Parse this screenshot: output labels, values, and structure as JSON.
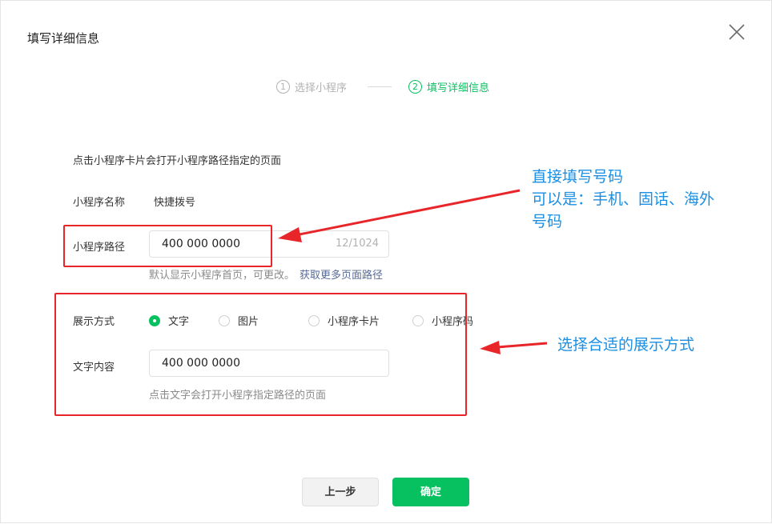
{
  "dialog": {
    "title": "填写详细信息"
  },
  "steps": [
    {
      "num": "1",
      "label": "选择小程序",
      "state": "inactive"
    },
    {
      "num": "2",
      "label": "填写详细信息",
      "state": "active"
    }
  ],
  "form": {
    "description": "点击小程序卡片会打开小程序路径指定的页面",
    "name_label": "小程序名称",
    "name_value": "快捷拨号",
    "path_label": "小程序路径",
    "path_value": "400 000 0000",
    "path_counter": "12/1024",
    "path_hint": "默认显示小程序首页，可更改。",
    "path_hint_link": "获取更多页面路径",
    "display_label": "展示方式",
    "display_options": [
      "文字",
      "图片",
      "小程序卡片",
      "小程序码"
    ],
    "display_selected": "文字",
    "text_label": "文字内容",
    "text_value": "400 000 0000",
    "text_hint": "点击文字会打开小程序指定路径的页面"
  },
  "annotations": {
    "top_line1": "直接填写号码",
    "top_line2": "可以是：手机、固话、海外",
    "top_line3": "号码",
    "bottom": "选择合适的展示方式"
  },
  "buttons": {
    "prev": "上一步",
    "ok": "确定"
  },
  "colors": {
    "accent": "#07c160",
    "annotation_red": "#e8262a",
    "annotation_blue": "#1a8fe3",
    "link": "#576b95"
  },
  "icons": {
    "close": "close-icon",
    "selected_radio": "radio-checked-icon",
    "radio": "radio-unchecked-icon"
  }
}
